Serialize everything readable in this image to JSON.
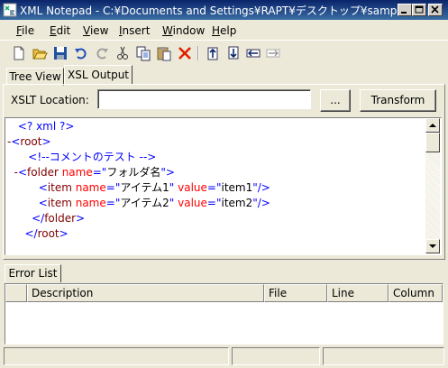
{
  "window": {
    "title": "XML Notepad - C:¥Documents and Settings¥RAPT¥デスクトップ¥sample.xml*"
  },
  "menu": {
    "items": [
      "File",
      "Edit",
      "View",
      "Insert",
      "Window",
      "Help"
    ]
  },
  "toolbar": {
    "icons": [
      "new-file",
      "open-folder",
      "save",
      "undo",
      "redo",
      "cut",
      "copy",
      "paste",
      "delete",
      "nudge-up",
      "nudge-down",
      "nudge-left",
      "nudge-right"
    ]
  },
  "tabs": {
    "tree_view": "Tree View",
    "xsl_output": "XSL Output"
  },
  "xsl": {
    "location_label": "XSLT Location:",
    "location_value": "",
    "browse_label": "...",
    "transform_label": "Transform"
  },
  "editor": {
    "lines": [
      {
        "indent": "",
        "toggle": "",
        "parts": [
          {
            "t": "<? ",
            "c": "blue"
          },
          {
            "t": "xml ?>",
            "c": "blue"
          }
        ]
      },
      {
        "indent": "",
        "toggle": "-",
        "parts": [
          {
            "t": "<",
            "c": "blue"
          },
          {
            "t": "root",
            "c": "maroon"
          },
          {
            "t": ">",
            "c": "blue"
          }
        ]
      },
      {
        "indent": "   ",
        "toggle": "",
        "parts": [
          {
            "t": "<!--コメントのテスト -->",
            "c": "blue"
          }
        ]
      },
      {
        "indent": "  ",
        "toggle": "-",
        "parts": [
          {
            "t": "<",
            "c": "blue"
          },
          {
            "t": "folder",
            "c": "maroon"
          },
          {
            "t": " name",
            "c": "red"
          },
          {
            "t": "=\"",
            "c": "blue"
          },
          {
            "t": "フォルダ名",
            "c": "black"
          },
          {
            "t": "\">",
            "c": "blue"
          }
        ]
      },
      {
        "indent": "      ",
        "toggle": "",
        "parts": [
          {
            "t": "<",
            "c": "blue"
          },
          {
            "t": "item",
            "c": "maroon"
          },
          {
            "t": " name",
            "c": "red"
          },
          {
            "t": "=\"",
            "c": "blue"
          },
          {
            "t": "アイテム1",
            "c": "black"
          },
          {
            "t": "\"",
            "c": "blue"
          },
          {
            "t": " value",
            "c": "red"
          },
          {
            "t": "=\"",
            "c": "blue"
          },
          {
            "t": "item1",
            "c": "black"
          },
          {
            "t": "\"/>",
            "c": "blue"
          }
        ]
      },
      {
        "indent": "      ",
        "toggle": "",
        "parts": [
          {
            "t": "<",
            "c": "blue"
          },
          {
            "t": "item",
            "c": "maroon"
          },
          {
            "t": " name",
            "c": "red"
          },
          {
            "t": "=\"",
            "c": "blue"
          },
          {
            "t": "アイテム2",
            "c": "black"
          },
          {
            "t": "\"",
            "c": "blue"
          },
          {
            "t": " value",
            "c": "red"
          },
          {
            "t": "=\"",
            "c": "blue"
          },
          {
            "t": "item2",
            "c": "black"
          },
          {
            "t": "\"/>",
            "c": "blue"
          }
        ]
      },
      {
        "indent": "    ",
        "toggle": "",
        "parts": [
          {
            "t": "</",
            "c": "blue"
          },
          {
            "t": "folder",
            "c": "maroon"
          },
          {
            "t": ">",
            "c": "blue"
          }
        ]
      },
      {
        "indent": "  ",
        "toggle": "",
        "parts": [
          {
            "t": "</",
            "c": "blue"
          },
          {
            "t": "root",
            "c": "maroon"
          },
          {
            "t": ">",
            "c": "blue"
          }
        ]
      }
    ]
  },
  "error_list": {
    "tab_label": "Error List",
    "columns": [
      "",
      "Description",
      "File",
      "Line",
      "Column"
    ],
    "rows": []
  },
  "status": {
    "panels": [
      "",
      "",
      ""
    ]
  },
  "colors": {
    "titlebar": "#0a246a",
    "chrome": "#ece9d8"
  }
}
